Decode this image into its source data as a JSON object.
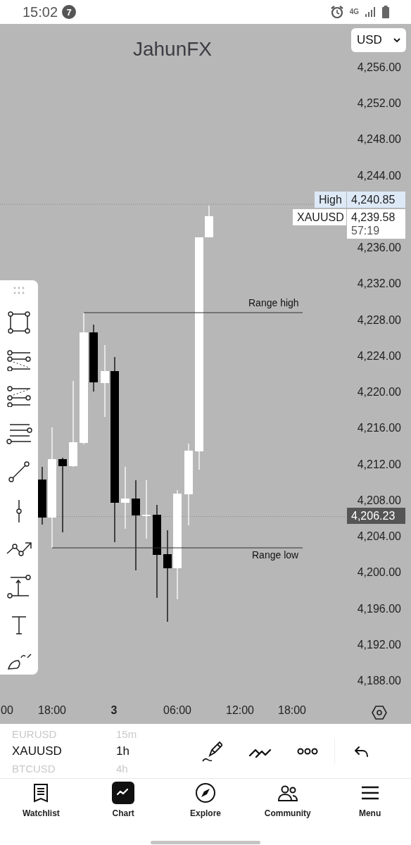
{
  "status_bar": {
    "time": "15:02",
    "notification_count": "7",
    "network": "4G"
  },
  "chart": {
    "currency": "USD",
    "watermark": "JahunFX",
    "price_axis": [
      "4,256.00",
      "4,252.00",
      "4,248.00",
      "4,244.00",
      "4,236.00",
      "4,232.00",
      "4,228.00",
      "4,224.00",
      "4,220.00",
      "4,216.00",
      "4,212.00",
      "4,208.00",
      "4,204.00",
      "4,200.00",
      "4,196.00",
      "4,192.00",
      "4,188.00"
    ],
    "high_marker": {
      "label": "High",
      "value": "4,240.85"
    },
    "last_price": {
      "symbol": "XAUUSD",
      "value": "4,239.58",
      "countdown": "57:19"
    },
    "current_price": "4,206.23",
    "annotations": [
      {
        "text": "Range high"
      },
      {
        "text": "Range low"
      }
    ],
    "time_axis": [
      {
        "label": "00",
        "kind": "time"
      },
      {
        "label": "18:00",
        "kind": "time"
      },
      {
        "label": "3",
        "kind": "day"
      },
      {
        "label": "06:00",
        "kind": "time"
      },
      {
        "label": "12:00",
        "kind": "time"
      },
      {
        "label": "18:00",
        "kind": "time"
      }
    ]
  },
  "symbol_picker": [
    {
      "symbol": "EURUSD",
      "interval": "15m",
      "selected": false
    },
    {
      "symbol": "XAUUSD",
      "interval": "1h",
      "selected": true
    },
    {
      "symbol": "BTCUSD",
      "interval": "4h",
      "selected": false
    }
  ],
  "bottom_nav": [
    {
      "label": "Watchlist",
      "selected": false
    },
    {
      "label": "Chart",
      "selected": true
    },
    {
      "label": "Explore",
      "selected": false
    },
    {
      "label": "Community",
      "selected": false
    },
    {
      "label": "Menu",
      "selected": false
    }
  ]
}
